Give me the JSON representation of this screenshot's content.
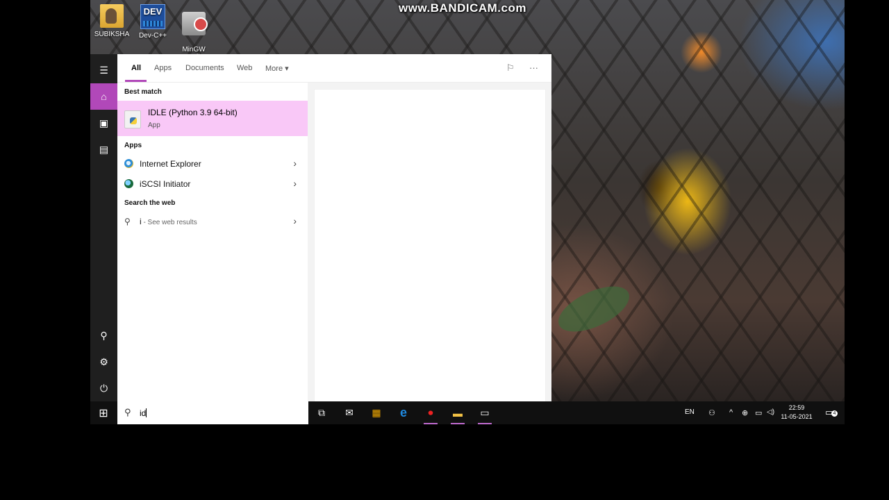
{
  "watermark": "www.BANDICAM.com",
  "desktop_icons": [
    {
      "label": "SUBIKSHA",
      "icon": "user-folder-icon"
    },
    {
      "label": "Dev-C++",
      "icon": "devcpp-icon",
      "badge": "DEV"
    },
    {
      "label": "MinGW\nInstaller",
      "icon": "mingw-installer-icon"
    }
  ],
  "rail": {
    "items": [
      {
        "icon": "hamburger-menu-icon",
        "glyph": "☰"
      },
      {
        "icon": "home-icon",
        "glyph": "⌂"
      },
      {
        "icon": "documents-icon",
        "glyph": "▣"
      },
      {
        "icon": "pictures-icon",
        "glyph": "▤"
      },
      {
        "icon": "account-icon",
        "glyph": "⚲"
      },
      {
        "icon": "settings-icon",
        "glyph": "⚙"
      },
      {
        "icon": "power-icon",
        "glyph": "⏻"
      }
    ]
  },
  "tabs": {
    "all": "All",
    "apps": "Apps",
    "documents": "Documents",
    "web": "Web",
    "more": "More ▾",
    "feedback_glyph": "⚐",
    "options_glyph": "···"
  },
  "results": {
    "best_match_heading": "Best match",
    "best_match": {
      "title": "IDLE (Python 3.9 64-bit)",
      "subtitle": "App"
    },
    "apps_heading": "Apps",
    "apps": [
      {
        "label": "Internet Explorer",
        "icon": "internet-explorer-icon"
      },
      {
        "label": "iSCSI Initiator",
        "icon": "iscsi-initiator-icon"
      }
    ],
    "web_heading": "Search the web",
    "web_query": "i",
    "web_suffix": " - See web results",
    "chevron": "›"
  },
  "search": {
    "value": "id",
    "glyph": "⚲"
  },
  "taskbar": {
    "start_glyph": "⊞",
    "apps": [
      {
        "icon": "task-view-icon",
        "glyph": "⧉"
      },
      {
        "icon": "mail-icon",
        "glyph": "✉"
      },
      {
        "icon": "store-icon",
        "glyph": "▦"
      },
      {
        "icon": "edge-icon",
        "glyph": "e"
      },
      {
        "icon": "bandicam-record-icon",
        "glyph": "⏺"
      },
      {
        "icon": "file-explorer-icon",
        "glyph": "▬"
      },
      {
        "icon": "terminal-icon",
        "glyph": "▭"
      }
    ],
    "tray": {
      "language": "EN",
      "people_glyph": "⚇",
      "chevron_up": "^",
      "wifi_glyph": "⊕",
      "battery_glyph": "▭",
      "volume_glyph": "◁)",
      "time": "22:59",
      "date": "11-05-2021",
      "notification_count": "4",
      "notification_glyph": "▭"
    }
  },
  "colors": {
    "accent": "#b148b9",
    "best_match_bg": "#f9c8f7"
  }
}
